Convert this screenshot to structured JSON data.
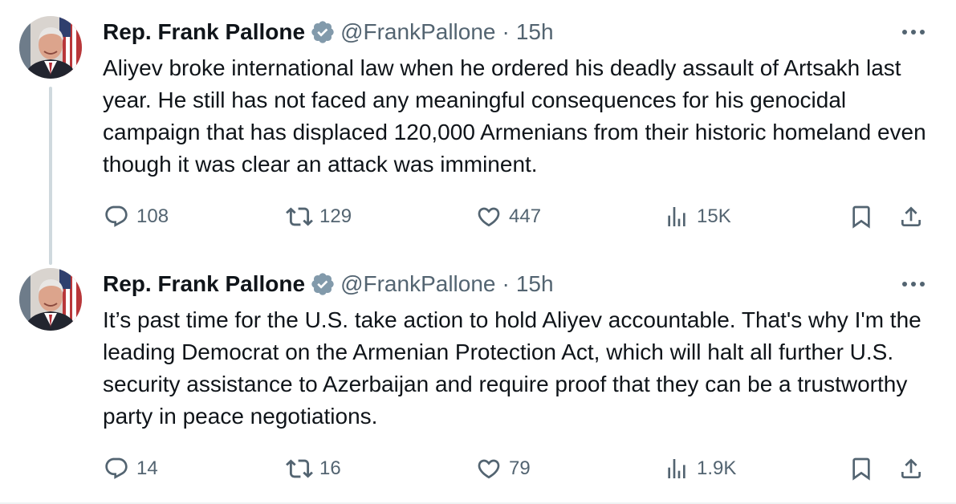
{
  "colors": {
    "text_primary": "#0f1419",
    "text_secondary": "#536471",
    "verified_badge": "#829aab",
    "thread_line": "#cfd9de"
  },
  "tweets": [
    {
      "author_name": "Rep. Frank Pallone",
      "handle": "@FrankPallone",
      "separator": "·",
      "time": "15h",
      "text": "Aliyev broke international law when he ordered his deadly assault of Artsakh last year. He still has not faced any meaningful consequences for his genocidal campaign that has displaced 120,000 Armenians from their historic homeland even though it was clear an attack was imminent.",
      "replies": "108",
      "retweets": "129",
      "likes": "447",
      "views": "15K",
      "icons": [
        "avatar",
        "verified-badge-icon",
        "more-icon",
        "reply-icon",
        "retweet-icon",
        "like-icon",
        "views-icon",
        "bookmark-icon",
        "share-icon"
      ]
    },
    {
      "author_name": "Rep. Frank Pallone",
      "handle": "@FrankPallone",
      "separator": "·",
      "time": "15h",
      "text": "It’s past time for the U.S. take action to hold Aliyev accountable. That's why I'm the leading Democrat on the Armenian Protection Act, which will halt all further U.S. security assistance to Azerbaijan and require proof that they can be a trustworthy party in peace negotiations.",
      "replies": "14",
      "retweets": "16",
      "likes": "79",
      "views": "1.9K",
      "icons": [
        "avatar",
        "verified-badge-icon",
        "more-icon",
        "reply-icon",
        "retweet-icon",
        "like-icon",
        "views-icon",
        "bookmark-icon",
        "share-icon"
      ]
    }
  ]
}
